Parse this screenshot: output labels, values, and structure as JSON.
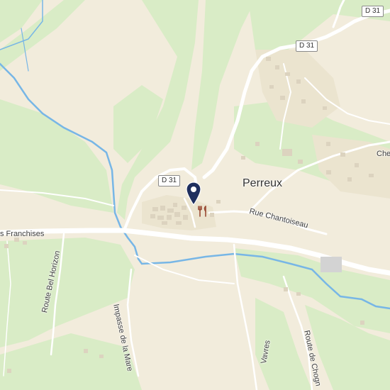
{
  "map": {
    "place_labels": {
      "perreux": "Perreux"
    },
    "street_labels": {
      "franchises": "s Franchises",
      "chantoiseau": "Rue Chantoiseau",
      "bel_horizon": "Route Bel Horizon",
      "impasse_mare": "Impasse de la Mare",
      "vavres": "Vavres",
      "chognat": "Route de Chogn",
      "che": "Che"
    },
    "road_shields": {
      "d31_top_right": "D 31",
      "d31_north": "D 31",
      "d31_center": "D 31"
    },
    "markers": {
      "location_pin": "map-pin-icon",
      "restaurant": "fork-knife-icon"
    },
    "colors": {
      "land": "#f2ecdc",
      "forest": "#d9ecc6",
      "water": "#77b6e6",
      "road": "#ffffff",
      "pin": "#1f2f5e",
      "poi": "#9a4b35"
    }
  }
}
